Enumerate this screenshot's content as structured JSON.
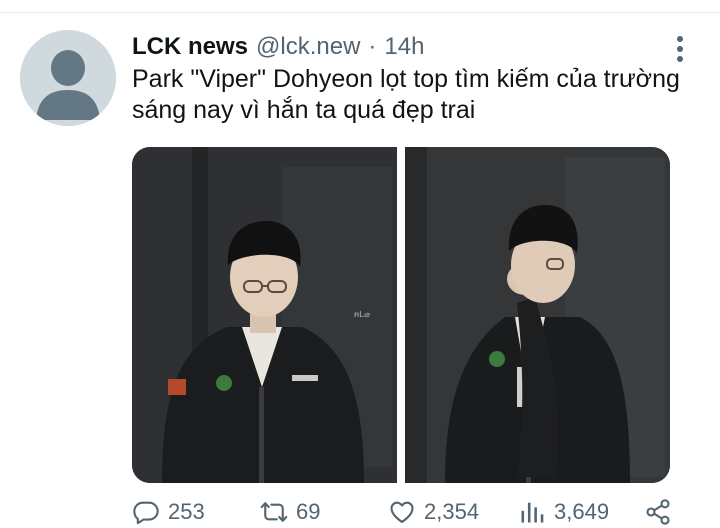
{
  "tweet": {
    "display_name": "LCK news",
    "handle": "@lck.new",
    "separator": "·",
    "time": "14h",
    "text": "Park \"Viper\" Dohyeon lọt top tìm kiếm của trường sáng nay vì hắn ta quá đẹp trai",
    "avatar": "default-avatar-icon"
  },
  "media": {
    "photos": [
      {
        "name": "photo-1",
        "watermark": "ꞥLᵢ⌀"
      },
      {
        "name": "photo-2"
      }
    ]
  },
  "actions": {
    "reply_count": "253",
    "retweet_count": "69",
    "like_count": "2,354",
    "view_count": "3,649",
    "icons": [
      "reply-icon",
      "retweet-icon",
      "like-icon",
      "views-icon",
      "share-icon"
    ]
  },
  "colors": {
    "text_primary": "#0f1419",
    "text_secondary": "#536471",
    "divider": "#e6ecf0",
    "avatar_bg": "#cfd9de"
  }
}
